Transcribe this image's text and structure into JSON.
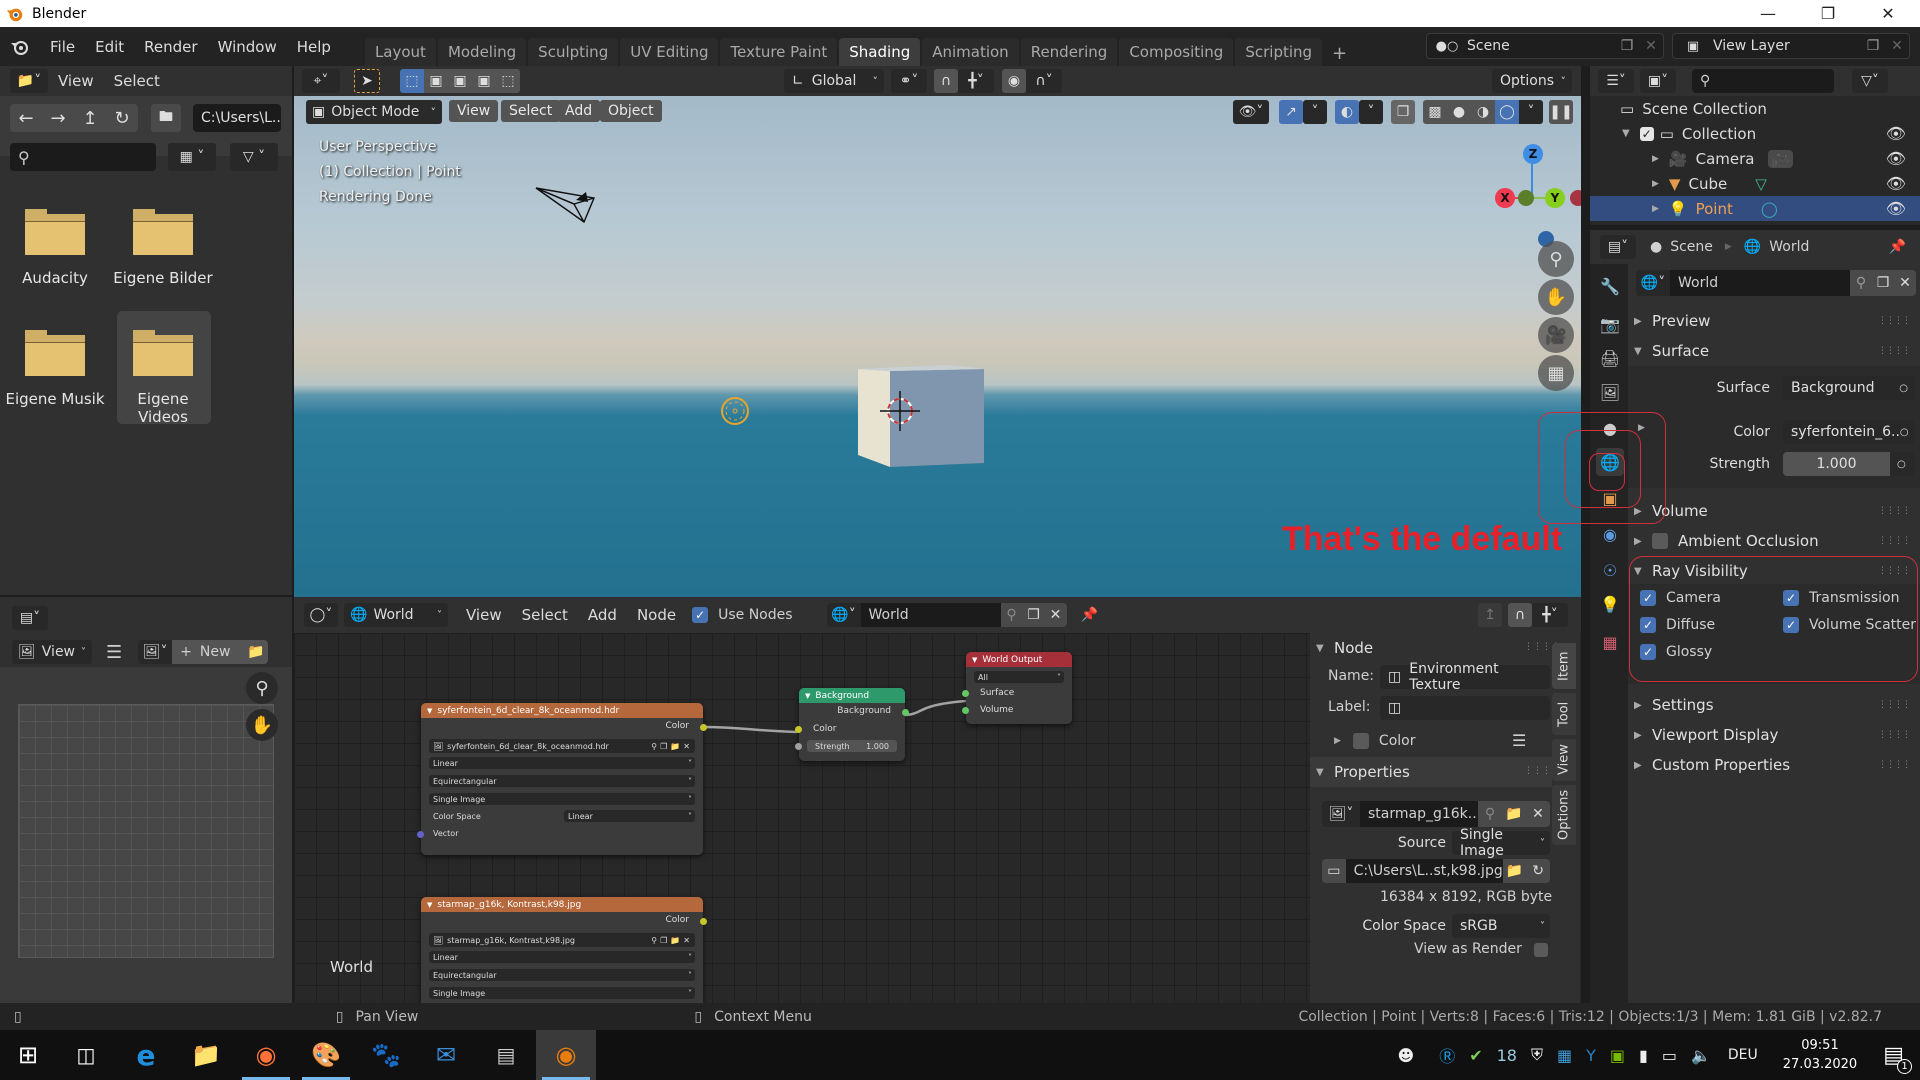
{
  "window": {
    "title": "Blender",
    "controls": [
      "minimize",
      "maximize",
      "close"
    ]
  },
  "menubar": {
    "items": [
      "File",
      "Edit",
      "Render",
      "Window",
      "Help"
    ]
  },
  "workspaces": {
    "tabs": [
      "Layout",
      "Modeling",
      "Sculpting",
      "UV Editing",
      "Texture Paint",
      "Shading",
      "Animation",
      "Rendering",
      "Compositing",
      "Scripting"
    ],
    "active": "Shading",
    "add_label": "+"
  },
  "scene_selector": {
    "value": "Scene"
  },
  "view_layer_selector": {
    "value": "View Layer"
  },
  "file_browser": {
    "header": {
      "view": "View",
      "select": "Select"
    },
    "path": "C:\\Users\\L..",
    "search_placeholder": "",
    "folders": [
      {
        "name": "Audacity",
        "selected": false
      },
      {
        "name": "Eigene Bilder",
        "selected": false
      },
      {
        "name": "Eigene Musik",
        "selected": false
      },
      {
        "name": "Eigene Videos",
        "selected": true
      }
    ]
  },
  "viewport": {
    "tool_header": {
      "orientation": "Global",
      "options": "Options"
    },
    "header": {
      "mode": "Object Mode",
      "menus": [
        "View",
        "Select",
        "Add",
        "Object"
      ]
    },
    "overlay_text": [
      "User Perspective",
      "(1) Collection | Point",
      "Rendering Done"
    ],
    "gizmo": {
      "x": "X",
      "y": "Y",
      "z": "Z"
    },
    "annotation": "That's the default",
    "annotation_color": "#e8202a"
  },
  "outliner": {
    "root": "Scene Collection",
    "items": [
      {
        "name": "Collection",
        "level": 1,
        "selected": false
      },
      {
        "name": "Camera",
        "level": 2,
        "selected": false
      },
      {
        "name": "Cube",
        "level": 2,
        "selected": false
      },
      {
        "name": "Point",
        "level": 2,
        "selected": true
      }
    ]
  },
  "properties": {
    "breadcrumb": [
      "Scene",
      "World"
    ],
    "world_name": "World",
    "sections": {
      "preview": "Preview",
      "surface": "Surface",
      "volume": "Volume",
      "ambient_occlusion": "Ambient Occlusion",
      "ray_visibility": "Ray Visibility",
      "settings": "Settings",
      "viewport_display": "Viewport Display",
      "custom_properties": "Custom Properties"
    },
    "surface": {
      "surface_label": "Surface",
      "surface_value": "Background",
      "color_label": "Color",
      "color_value": "syferfontein_6..",
      "strength_label": "Strength",
      "strength_value": "1.000"
    },
    "ambient_occlusion_enabled": false,
    "ray_visibility": [
      {
        "label": "Camera",
        "checked": true
      },
      {
        "label": "Transmission",
        "checked": true
      },
      {
        "label": "Diffuse",
        "checked": true
      },
      {
        "label": "Volume Scatter",
        "checked": true
      },
      {
        "label": "Glossy",
        "checked": true
      }
    ]
  },
  "node_editor": {
    "header": {
      "type": "World",
      "menus": [
        "View",
        "Select",
        "Add",
        "Node"
      ],
      "use_nodes_label": "Use Nodes",
      "use_nodes": true,
      "world": "World"
    },
    "corner_label": "World",
    "nodes": {
      "env1": {
        "title": "syferfontein_6d_clear_8k_oceanmod.hdr",
        "output": "Color",
        "image": "syferfontein_6d_clear_8k_oceanmod.hdr",
        "interpolation": "Linear",
        "projection": "Equirectangular",
        "source": "Single Image",
        "color_space_label": "Color Space",
        "color_space": "Linear",
        "input": "Vector"
      },
      "env2": {
        "title": "starmap_g16k, Kontrast,k98.jpg",
        "output": "Color",
        "image": "starmap_g16k, Kontrast,k98.jpg",
        "interpolation": "Linear",
        "projection": "Equirectangular",
        "source": "Single Image"
      },
      "background": {
        "title": "Background",
        "output": "Background",
        "color": "Color",
        "strength_label": "Strength",
        "strength": "1.000"
      },
      "world_output": {
        "title": "World Output",
        "target": "All",
        "surface": "Surface",
        "volume": "Volume"
      }
    },
    "colors": {
      "texture_header": "#b5683b",
      "shader_header": "#2e9a6b",
      "output_header": "#a5303a"
    },
    "sidebar": {
      "tabs": [
        "Item",
        "Tool",
        "View",
        "Options"
      ],
      "node_section": "Node",
      "name_label": "Name:",
      "name_value": "Environment Texture",
      "label_label": "Label:",
      "label_value": "",
      "color_label": "Color",
      "properties_section": "Properties",
      "image": "starmap_g16k..",
      "source_label": "Source",
      "source_value": "Single Image",
      "filepath": "C:\\Users\\L..st,k98.jpg",
      "image_info": "16384 x 8192,  RGB byte",
      "color_space_label": "Color Space",
      "color_space_value": "sRGB",
      "view_as_render_label": "View as Render",
      "view_as_render": false
    }
  },
  "image_editor": {
    "view": "View",
    "new": "New"
  },
  "statusbar": {
    "left_hint": "",
    "middle_hint": "Pan View",
    "right_hint": "Context Menu",
    "stats": "Collection | Point | Verts:8 | Faces:6 | Tris:12 | Objects:1/3 | Mem: 1.81 GiB | v2.82.7"
  },
  "taskbar": {
    "apps": [
      "start",
      "task-view",
      "edge",
      "file-explorer",
      "firefox",
      "paint",
      "gimp",
      "thunderbird",
      "typewriter-app",
      "blender"
    ],
    "language": "DEU",
    "time": "09:51",
    "date": "27.03.2020",
    "notification_count": "1"
  }
}
